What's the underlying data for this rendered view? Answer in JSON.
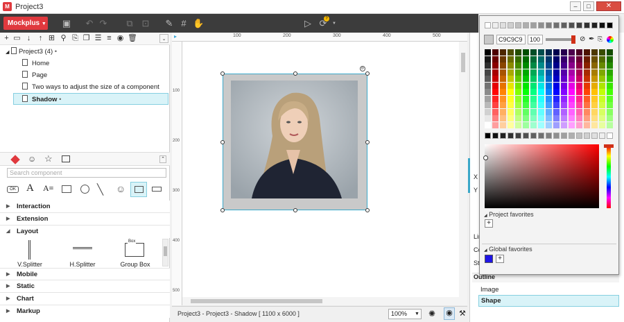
{
  "window": {
    "title": "Project3",
    "app_icon": "M"
  },
  "toolbar": {
    "brand": "Mockplus"
  },
  "project_tree": {
    "root": "Project3 (4)",
    "pages": [
      "Home",
      "Page",
      "Two ways to adjust the size of a component",
      "Shadow"
    ],
    "selected": "Shadow"
  },
  "component_panel": {
    "search_placeholder": "Search component",
    "categories": [
      "Interaction",
      "Extension",
      "Layout",
      "Mobile",
      "Static",
      "Chart",
      "Markup"
    ],
    "layout_items": [
      "V.Splitter",
      "H.Splitter",
      "Group Box"
    ],
    "group_box_caption": "Box"
  },
  "rulers": {
    "top": [
      "100",
      "200",
      "300",
      "400",
      "500"
    ],
    "left": [
      "100",
      "200",
      "300",
      "400",
      "500"
    ]
  },
  "status": {
    "text": "Project3 - Project3 - Shadow [ 1100 x 6000 ]",
    "zoom": "100%"
  },
  "right_panel": {
    "labels": [
      "X",
      "Y",
      "Lin",
      "Co",
      "St"
    ],
    "outline_title": "Outline",
    "outline_items": [
      "Image",
      "Shape"
    ],
    "outline_selected": "Shape"
  },
  "color_picker": {
    "hex_value": "C9C9C9",
    "opacity_value": "100",
    "project_favorites": "Project favorites",
    "global_favorites": "Global favorites",
    "global_favorite_color": "#1e14e6",
    "current_color": "#c9c9c9"
  }
}
